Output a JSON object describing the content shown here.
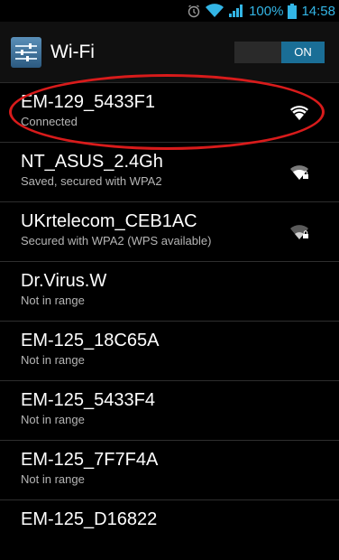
{
  "status_bar": {
    "battery": "100%",
    "time": "14:58",
    "icons": [
      "alarm-icon",
      "wifi-icon",
      "signal-icon",
      "battery-icon"
    ]
  },
  "action_bar": {
    "title": "Wi-Fi",
    "toggle_label": "ON"
  },
  "networks": [
    {
      "ssid": "EM-129_5433F1",
      "status": "Connected",
      "signal": "wifi-connected-icon"
    },
    {
      "ssid": "NT_ASUS_2.4Gh",
      "status": "Saved, secured with WPA2",
      "signal": "wifi-secured-icon"
    },
    {
      "ssid": "UKrtelecom_CEB1AC",
      "status": "Secured with WPA2 (WPS available)",
      "signal": "wifi-secured-weak-icon"
    },
    {
      "ssid": "Dr.Virus.W",
      "status": "Not in range"
    },
    {
      "ssid": "EM-125_18C65A",
      "status": "Not in range"
    },
    {
      "ssid": "EM-125_5433F4",
      "status": "Not in range"
    },
    {
      "ssid": "EM-125_7F7F4A",
      "status": "Not in range"
    },
    {
      "ssid": "EM-125_D16822",
      "status": ""
    }
  ],
  "colors": {
    "accent": "#33b5e5",
    "highlight": "#d81b1b"
  }
}
